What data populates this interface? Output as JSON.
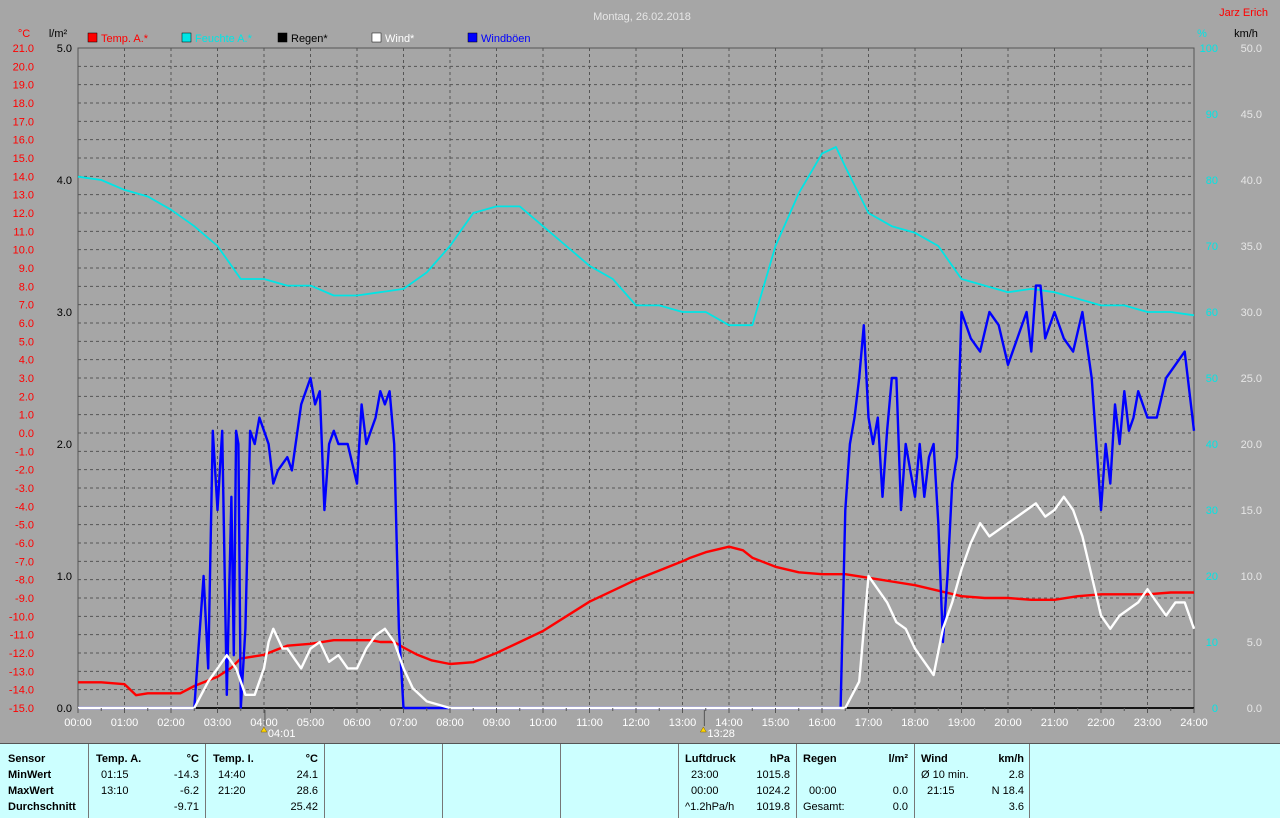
{
  "title": "Montag, 26.02.2018",
  "author": "Jarz Erich",
  "colors": {
    "temp": "#ff0000",
    "humidity": "#00e5e5",
    "rain": "#000000",
    "wind": "#ffffff",
    "gusts": "#0000ff",
    "background": "#a6a6a6",
    "table_bg": "#ccffff"
  },
  "chart_data": {
    "type": "line",
    "title": "Montag, 26.02.2018",
    "x_ticks": [
      "00:00",
      "01:00",
      "02:00",
      "03:00",
      "04:00",
      "05:00",
      "06:00",
      "07:00",
      "08:00",
      "09:00",
      "10:00",
      "11:00",
      "12:00",
      "13:00",
      "14:00",
      "15:00",
      "16:00",
      "17:00",
      "18:00",
      "19:00",
      "20:00",
      "21:00",
      "22:00",
      "23:00",
      "24:00"
    ],
    "xlim": [
      0,
      24
    ],
    "axes": {
      "temp": {
        "unit": "°C",
        "range": [
          -15,
          21
        ],
        "ticks": [
          "21.0",
          "20.0",
          "19.0",
          "18.0",
          "17.0",
          "16.0",
          "15.0",
          "14.0",
          "13.0",
          "12.0",
          "11.0",
          "10.0",
          "9.0",
          "8.0",
          "7.0",
          "6.0",
          "5.0",
          "4.0",
          "3.0",
          "2.0",
          "1.0",
          "0.0",
          "-1.0",
          "-2.0",
          "-3.0",
          "-4.0",
          "-5.0",
          "-6.0",
          "-7.0",
          "-8.0",
          "-9.0",
          "-10.0",
          "-11.0",
          "-12.0",
          "-13.0",
          "-14.0",
          "-15.0"
        ]
      },
      "rain": {
        "unit": "l/m²",
        "range": [
          0,
          5
        ],
        "ticks": [
          "5.0",
          "4.0",
          "3.0",
          "2.0",
          "1.0",
          "0.0"
        ]
      },
      "humidity": {
        "unit": "%",
        "range": [
          0,
          100
        ],
        "ticks": [
          "100",
          "90",
          "80",
          "70",
          "60",
          "50",
          "40",
          "30",
          "20",
          "10",
          "0"
        ]
      },
      "wind": {
        "unit": "km/h",
        "range": [
          0,
          50
        ],
        "ticks": [
          "50.0",
          "45.0",
          "40.0",
          "35.0",
          "30.0",
          "25.0",
          "20.0",
          "15.0",
          "10.0",
          "5.0",
          "0.0"
        ]
      }
    },
    "legend": [
      "Temp. A.*",
      "Feuchte A.*",
      "Regen*",
      "Wind*",
      "Windböen"
    ],
    "series": [
      {
        "name": "Temp. A.*",
        "axis": "temp",
        "color": "#ff0000",
        "x": [
          0,
          0.5,
          1.0,
          1.25,
          1.5,
          2.0,
          2.2,
          2.5,
          3.0,
          3.3,
          3.5,
          3.75,
          4.0,
          4.3,
          4.5,
          5.0,
          5.5,
          6.0,
          6.3,
          6.5,
          6.8,
          7.0,
          7.3,
          7.6,
          8.0,
          8.5,
          9.0,
          9.5,
          10.0,
          10.5,
          11.0,
          11.5,
          12.0,
          12.5,
          13.0,
          13.17,
          13.5,
          14.0,
          14.3,
          14.5,
          15.0,
          15.5,
          16.0,
          16.5,
          17.0,
          17.5,
          18.0,
          18.5,
          19.0,
          19.5,
          20.0,
          20.5,
          21.0,
          21.5,
          22.0,
          22.5,
          23.0,
          23.5,
          24.0
        ],
        "values": [
          -13.6,
          -13.6,
          -13.7,
          -14.3,
          -14.2,
          -14.2,
          -14.2,
          -13.8,
          -13.3,
          -12.8,
          -12.3,
          -12.2,
          -12.1,
          -11.8,
          -11.6,
          -11.5,
          -11.3,
          -11.3,
          -11.3,
          -11.4,
          -11.4,
          -11.7,
          -12.1,
          -12.4,
          -12.6,
          -12.5,
          -12.0,
          -11.4,
          -10.8,
          -10.0,
          -9.2,
          -8.6,
          -8.0,
          -7.5,
          -7.0,
          -6.8,
          -6.5,
          -6.2,
          -6.4,
          -6.8,
          -7.3,
          -7.6,
          -7.7,
          -7.7,
          -7.9,
          -8.1,
          -8.3,
          -8.6,
          -8.9,
          -9.0,
          -9.0,
          -9.1,
          -9.1,
          -8.9,
          -8.8,
          -8.8,
          -8.8,
          -8.7,
          -8.7
        ]
      },
      {
        "name": "Feuchte A.*",
        "axis": "humidity",
        "color": "#00e5e5",
        "x": [
          0,
          0.5,
          1.0,
          1.5,
          2.0,
          2.5,
          3.0,
          3.5,
          4.0,
          4.5,
          5.0,
          5.5,
          6.0,
          6.5,
          7.0,
          7.5,
          8.0,
          8.5,
          9.0,
          9.5,
          10.0,
          10.5,
          11.0,
          11.5,
          12.0,
          12.5,
          13.0,
          13.5,
          14.0,
          14.5,
          15.0,
          15.5,
          16.0,
          16.3,
          16.5,
          17.0,
          17.5,
          18.0,
          18.5,
          19.0,
          19.5,
          20.0,
          20.5,
          21.0,
          21.5,
          22.0,
          22.5,
          23.0,
          23.5,
          24.0
        ],
        "values": [
          80.5,
          80,
          78.5,
          77.5,
          75.5,
          73,
          70,
          65,
          65,
          64,
          64,
          62.5,
          62.5,
          63,
          63.5,
          66,
          70,
          75,
          76,
          76,
          73,
          70,
          67,
          65,
          61,
          61,
          60,
          60,
          58,
          58,
          70,
          78,
          84,
          85,
          82,
          75,
          73,
          72,
          70,
          65,
          64,
          63,
          63.5,
          63,
          62,
          61,
          61,
          60,
          60,
          59.5
        ]
      },
      {
        "name": "Regen*",
        "axis": "rain",
        "color": "#000000",
        "x": [
          0,
          24
        ],
        "values": [
          0,
          0
        ]
      },
      {
        "name": "Wind*",
        "axis": "wind",
        "color": "#ffffff",
        "x": [
          0,
          2.5,
          2.8,
          3.0,
          3.2,
          3.4,
          3.5,
          3.6,
          3.8,
          4.0,
          4.1,
          4.2,
          4.4,
          4.5,
          4.8,
          5.0,
          5.2,
          5.4,
          5.6,
          5.8,
          6.0,
          6.2,
          6.4,
          6.6,
          6.8,
          7.0,
          7.2,
          7.5,
          8.0,
          8.3,
          16.5,
          16.8,
          17.0,
          17.2,
          17.4,
          17.6,
          17.8,
          18.0,
          18.2,
          18.4,
          18.6,
          18.8,
          19.0,
          19.2,
          19.4,
          19.6,
          19.8,
          20.0,
          20.2,
          20.4,
          20.6,
          20.8,
          21.0,
          21.2,
          21.4,
          21.6,
          21.8,
          22.0,
          22.2,
          22.4,
          22.6,
          22.8,
          23.0,
          23.2,
          23.4,
          23.6,
          23.8,
          24.0
        ],
        "values": [
          0,
          0,
          2,
          3,
          4,
          3,
          2,
          1,
          1,
          3,
          5,
          6,
          4.5,
          4.5,
          3,
          4.5,
          5,
          3.5,
          4,
          3,
          3,
          4.5,
          5.5,
          6,
          5,
          3,
          1.5,
          0.5,
          0,
          0,
          0,
          2,
          10,
          9,
          8,
          6.5,
          6,
          4.5,
          3.5,
          2.5,
          6,
          8,
          10.5,
          12.5,
          14,
          13,
          13.5,
          14,
          14.5,
          15,
          15.5,
          14.5,
          15,
          16,
          15,
          13,
          10,
          7,
          6,
          7,
          7.5,
          8,
          9,
          8,
          7,
          8,
          8,
          6
        ]
      },
      {
        "name": "Windböen",
        "axis": "wind",
        "color": "#0000ff",
        "x": [
          0,
          2.5,
          2.7,
          2.8,
          2.9,
          3.0,
          3.1,
          3.2,
          3.3,
          3.35,
          3.4,
          3.45,
          3.5,
          3.6,
          3.7,
          3.8,
          3.9,
          4.0,
          4.1,
          4.2,
          4.3,
          4.5,
          4.6,
          4.8,
          5.0,
          5.1,
          5.2,
          5.3,
          5.4,
          5.5,
          5.6,
          5.8,
          6.0,
          6.1,
          6.2,
          6.3,
          6.4,
          6.5,
          6.6,
          6.7,
          6.8,
          6.9,
          7.0,
          7.1,
          16.4,
          16.5,
          16.6,
          16.7,
          16.8,
          16.9,
          17.0,
          17.1,
          17.2,
          17.3,
          17.4,
          17.5,
          17.6,
          17.7,
          17.8,
          17.9,
          18.0,
          18.1,
          18.2,
          18.3,
          18.4,
          18.5,
          18.6,
          18.7,
          18.8,
          18.9,
          19.0,
          19.2,
          19.4,
          19.6,
          19.8,
          20.0,
          20.2,
          20.4,
          20.5,
          20.6,
          20.7,
          20.8,
          21.0,
          21.2,
          21.4,
          21.6,
          21.8,
          22.0,
          22.1,
          22.2,
          22.3,
          22.4,
          22.5,
          22.6,
          22.7,
          22.8,
          22.9,
          23.0,
          23.2,
          23.4,
          23.6,
          23.8,
          24.0
        ],
        "values": [
          0,
          0,
          10,
          3,
          21,
          15,
          21,
          1,
          16,
          4,
          21,
          20,
          0,
          6,
          21,
          20,
          22,
          21,
          20,
          17,
          18,
          19,
          18,
          23,
          25,
          23,
          24,
          15,
          20,
          21,
          20,
          20,
          17,
          23,
          20,
          21,
          22,
          24,
          23,
          24,
          20,
          6,
          0,
          0,
          0,
          15,
          20,
          22,
          25,
          29,
          22,
          20,
          22,
          16,
          21,
          25,
          25,
          15,
          20,
          18,
          16,
          20,
          16,
          19,
          20,
          14,
          5,
          10,
          17,
          19,
          30,
          28,
          27,
          30,
          29,
          26,
          28,
          30,
          27,
          32,
          32,
          28,
          30,
          28,
          27,
          30,
          25,
          15,
          20,
          17,
          23,
          20,
          24,
          21,
          22,
          24,
          23,
          22,
          22,
          25,
          26,
          27,
          21
        ]
      }
    ]
  },
  "stats": {
    "sensor_label": "Sensor",
    "row_labels": [
      "MinWert",
      "MaxWert",
      "Durchschnitt"
    ],
    "temp_a": {
      "title": "Temp. A.",
      "unit": "°C",
      "min_time": "01:15",
      "min": "-14.3",
      "max_time": "13:10",
      "max": "-6.2",
      "avg": "-9.71"
    },
    "temp_i": {
      "title": "Temp. I.",
      "unit": "°C",
      "min_time": "14:40",
      "min": "24.1",
      "max_time": "21:20",
      "max": "28.6",
      "avg": "25.42"
    },
    "pressure": {
      "title": "Luftdruck",
      "unit": "hPa",
      "min_time": "23:00",
      "min": "1015.8",
      "max_time": "00:00",
      "max": "1024.2",
      "trend": "^1.2hPa/h",
      "avg": "1019.8"
    },
    "rain": {
      "title": "Regen",
      "unit": "l/m²",
      "max_time": "00:00",
      "max": "0.0",
      "total_label": "Gesamt:",
      "total": "0.0"
    },
    "wind": {
      "title": "Wind",
      "unit": "km/h",
      "avg10_label": "Ø 10 min.",
      "avg10": "2.8",
      "gust_time": "21:15",
      "gust": "N 18.4",
      "avg": "3.6"
    }
  },
  "markers": [
    {
      "time": "04:01",
      "hour": 4.02
    },
    {
      "time": "13:28",
      "hour": 13.47
    }
  ]
}
